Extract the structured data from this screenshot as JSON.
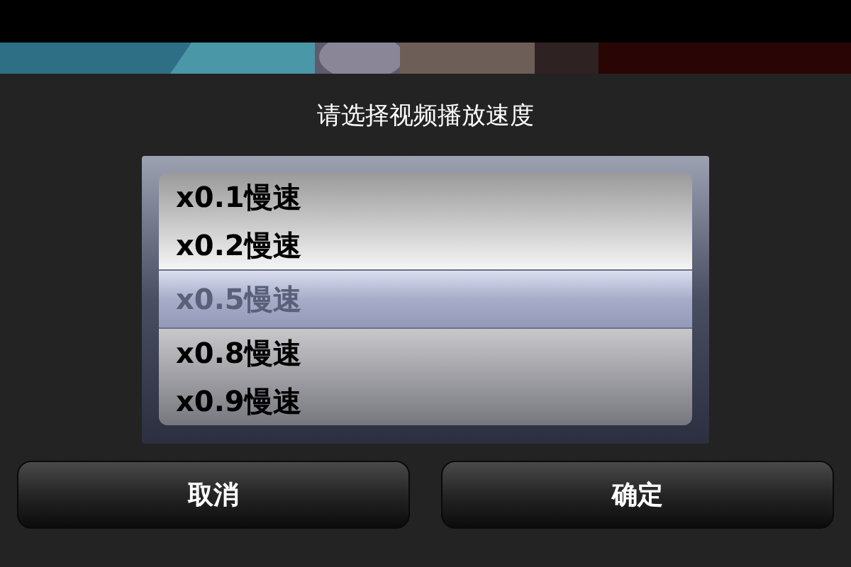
{
  "dialog": {
    "title": "请选择视频播放速度"
  },
  "picker": {
    "options": [
      {
        "label": "x0.1慢速",
        "selected": false
      },
      {
        "label": "x0.2慢速",
        "selected": false
      },
      {
        "label": "x0.5慢速",
        "selected": true
      },
      {
        "label": "x0.8慢速",
        "selected": false
      },
      {
        "label": "x0.9慢速",
        "selected": false
      }
    ]
  },
  "buttons": [
    {
      "label": "取消"
    },
    {
      "label": "确定"
    }
  ]
}
